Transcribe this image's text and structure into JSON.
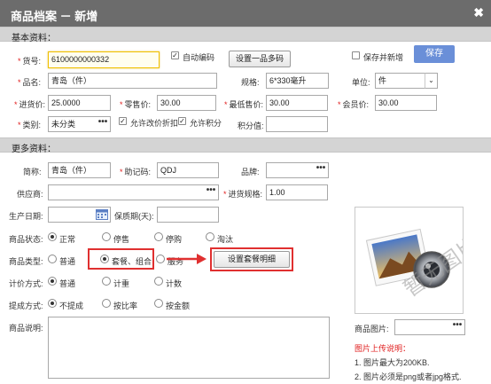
{
  "dialog": {
    "title": "商品档案 － 新增"
  },
  "sections": {
    "basic": "基本资料：",
    "more": "更多资料："
  },
  "basic": {
    "code_label": "货号:",
    "code_value": "6100000000332",
    "auto_code": "自动编码",
    "multi_code_btn": "设置一品多码",
    "save_new": "保存并新增",
    "save_btn": "保存",
    "name_label": "品名:",
    "name_value": "青岛（件）",
    "spec_label": "规格:",
    "spec_value": "6*330毫升",
    "unit_label": "单位:",
    "unit_value": "件",
    "cost_label": "进货价:",
    "cost_value": "25.0000",
    "retail_label": "零售价:",
    "retail_value": "30.00",
    "min_label": "最低售价:",
    "min_value": "30.00",
    "member_label": "会员价:",
    "member_value": "30.00",
    "cat_label": "类别:",
    "cat_value": "未分类",
    "allow_discount": "允许改价折扣",
    "allow_points": "允许积分",
    "points_label": "积分值:"
  },
  "more": {
    "short_label": "简称:",
    "short_value": "青岛（件）",
    "mnemonic_label": "助记码:",
    "mnemonic_value": "QDJ",
    "brand_label": "品牌:",
    "supplier_label": "供应商:",
    "purchase_spec_label": "进货规格:",
    "purchase_spec_value": "1.00",
    "prod_date_label": "生产日期:",
    "shelf_label": "保质期(天):",
    "status_label": "商品状态:",
    "status_options": [
      "正常",
      "停售",
      "停购",
      "淘汰"
    ],
    "type_label": "商品类型:",
    "type_options": [
      "普通",
      "套餐、组合",
      "服务"
    ],
    "combo_btn": "设置套餐明细",
    "price_label": "计价方式:",
    "price_options": [
      "普通",
      "计重",
      "计数"
    ],
    "comm_label": "提成方式:",
    "comm_options": [
      "不提成",
      "按比率",
      "按金额"
    ],
    "desc_label": "商品说明:",
    "img_label": "商品图片:",
    "img_placeholder_text": "暂无图片",
    "upload_title": "图片上传说明：",
    "upload_notes": [
      "1. 图片最大为200KB.",
      "2. 图片必须是png或者jpg格式."
    ]
  }
}
